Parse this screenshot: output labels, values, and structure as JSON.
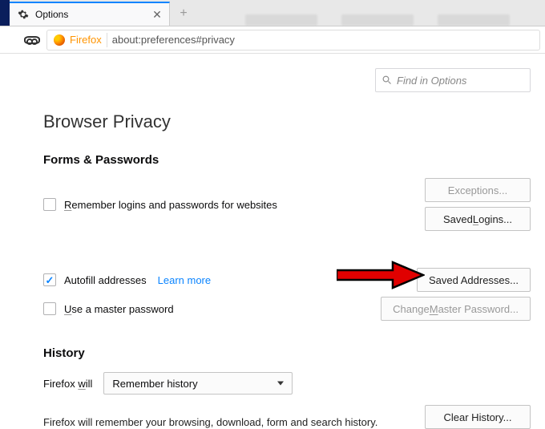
{
  "tab": {
    "title": "Options"
  },
  "urlbar": {
    "browser_label": "Firefox",
    "url": "about:preferences#privacy"
  },
  "search": {
    "placeholder": "Find in Options"
  },
  "headings": {
    "browser_privacy": "Browser Privacy",
    "forms_passwords": "Forms & Passwords",
    "history": "History"
  },
  "forms": {
    "remember_prefix": "R",
    "remember_rest": "emember logins and passwords for websites",
    "autofill": "Autofill addresses",
    "learn_more": "Learn more",
    "master_prefix": "U",
    "master_rest": "se a master password",
    "exceptions": "Exceptions...",
    "saved_logins_pre": "Saved ",
    "saved_logins_u": "L",
    "saved_logins_post": "ogins...",
    "saved_addresses": "Saved Addresses...",
    "change_master_pre": "Change ",
    "change_master_u": "M",
    "change_master_post": "aster Password..."
  },
  "history_section": {
    "label_pre": "Firefox ",
    "label_u": "w",
    "label_post": "ill",
    "select_value": "Remember history",
    "desc": "Firefox will remember your browsing, download, form and search history.",
    "clear": "Clear History..."
  }
}
